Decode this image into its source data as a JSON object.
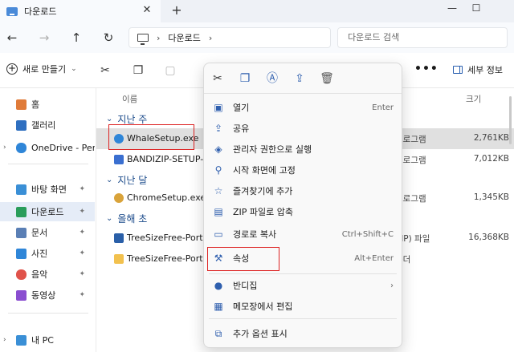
{
  "window": {
    "tab_title": "다운로드",
    "close_tab": "✕",
    "new_tab": "+",
    "minimize": "—",
    "maximize": "☐"
  },
  "nav": {
    "back": "←",
    "forward": "→",
    "up": "↑",
    "refresh": "↻",
    "breadcrumb_chevron_1": "›",
    "breadcrumb_folder": "다운로드",
    "breadcrumb_chevron_2": "›",
    "search_placeholder": "다운로드 검색"
  },
  "toolbar": {
    "new_label": "새로 만들기",
    "new_chevron": "⌄",
    "more": "•••",
    "details_label": "세부 정보"
  },
  "sidebar": {
    "items": [
      {
        "label": "홈",
        "color": "#e07b39"
      },
      {
        "label": "갤러리",
        "color": "#2f6fc0"
      },
      {
        "label": "OneDrive - Pers",
        "color": "#2f86d8"
      },
      {
        "label": "바탕 화면",
        "color": "#3a8fd6"
      },
      {
        "label": "다운로드",
        "color": "#2a9d5a"
      },
      {
        "label": "문서",
        "color": "#5a7fb5"
      },
      {
        "label": "사진",
        "color": "#2f86d8"
      },
      {
        "label": "음악",
        "color": "#e0534b"
      },
      {
        "label": "동영상",
        "color": "#8a4ed0"
      },
      {
        "label": "내 PC",
        "color": "#3a8fd6"
      }
    ],
    "pin_glyph": "📌",
    "expand_glyph": "›"
  },
  "content": {
    "col_name": "이름",
    "col_size": "크기",
    "groups": [
      "지난 주",
      "지난 달",
      "올해 초"
    ],
    "rows": [
      {
        "name": "WhaleSetup.exe",
        "type": "프로그램",
        "size": "2,761KB",
        "color": "#2f86d8"
      },
      {
        "name": "BANDIZIP-SETUP-STD",
        "type": "프로그램",
        "size": "7,012KB",
        "color": "#3a6fd0"
      },
      {
        "name": "ChromeSetup.exe",
        "type": "프로그램",
        "size": "1,345KB",
        "color": "#d9a33a"
      },
      {
        "name": "TreeSizeFree-Portable",
        "type": "ZIP) 파일",
        "size": "16,368KB",
        "color": "#2a5fa8"
      },
      {
        "name": "TreeSizeFree-Portable",
        "type": "폴더",
        "size": "",
        "color": "#f2c14e"
      }
    ]
  },
  "context_menu": {
    "top_icons": [
      "cut-icon",
      "copy-icon",
      "rename-icon",
      "share-icon",
      "delete-icon"
    ],
    "items": [
      {
        "label": "열기",
        "shortcut": "Enter",
        "icon": "▣"
      },
      {
        "label": "공유",
        "shortcut": "",
        "icon": "⇪"
      },
      {
        "label": "관리자 권한으로 실행",
        "shortcut": "",
        "icon": "◈"
      },
      {
        "label": "시작 화면에 고정",
        "shortcut": "",
        "icon": "⚲"
      },
      {
        "label": "즐겨찾기에 추가",
        "shortcut": "",
        "icon": "☆"
      },
      {
        "label": "ZIP 파일로 압축",
        "shortcut": "",
        "icon": "▤"
      },
      {
        "label": "경로로 복사",
        "shortcut": "Ctrl+Shift+C",
        "icon": "▭"
      },
      {
        "label": "속성",
        "shortcut": "Alt+Enter",
        "icon": "⚒"
      },
      {
        "label": "반디집",
        "shortcut": "›",
        "icon": "●"
      },
      {
        "label": "메모장에서 편집",
        "shortcut": "",
        "icon": "▦"
      },
      {
        "label": "추가 옵션 표시",
        "shortcut": "",
        "icon": "⧉"
      }
    ]
  },
  "colors": {
    "highlight_box": "#dd2222",
    "accent": "#2f5fae"
  }
}
